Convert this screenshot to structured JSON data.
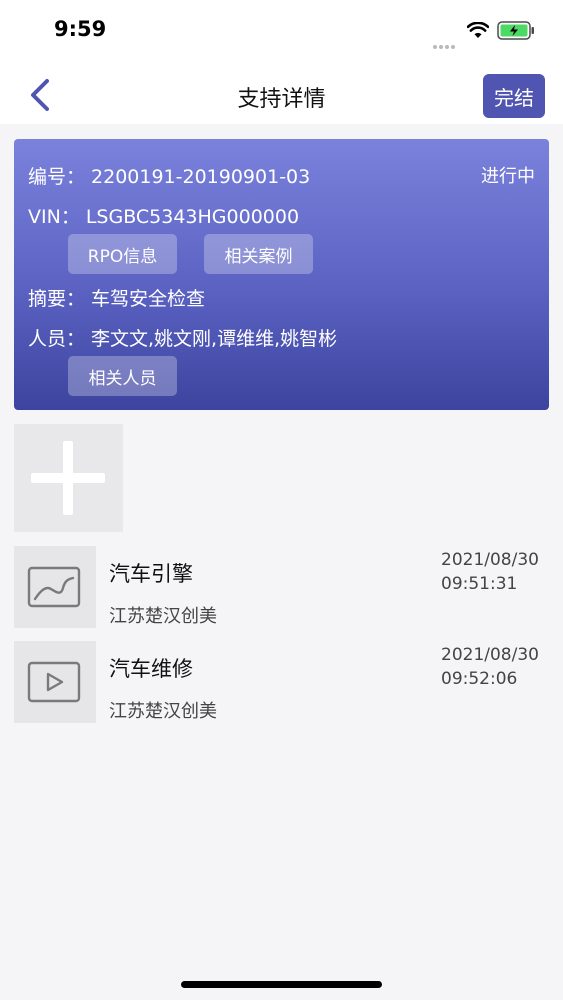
{
  "status_bar": {
    "time": "9:59"
  },
  "nav": {
    "title": "支持详情",
    "done_label": "完结"
  },
  "card": {
    "id_label": "编号：",
    "id_value": "2200191-20190901-03",
    "status": "进行中",
    "vin_label": "VIN：",
    "vin_value": "LSGBC5343HG000000",
    "rpo_button": "RPO信息",
    "cases_button": "相关案例",
    "summary_label": "摘要：",
    "summary_value": "车驾安全检查",
    "people_label": "人员：",
    "people_value": "李文文,姚文刚,谭维维,姚智彬",
    "people_button": "相关人员"
  },
  "items": [
    {
      "title": "汽车引擎",
      "company": "江苏楚汉创美",
      "date": "2021/08/30",
      "time": "09:51:31",
      "icon": "image-icon"
    },
    {
      "title": "汽车维修",
      "company": "江苏楚汉创美",
      "date": "2021/08/30",
      "time": "09:52:06",
      "icon": "video-icon"
    }
  ],
  "colors": {
    "accent": "#4f55b0",
    "card_top": "#7b82dc",
    "card_bottom": "#3c449f"
  }
}
